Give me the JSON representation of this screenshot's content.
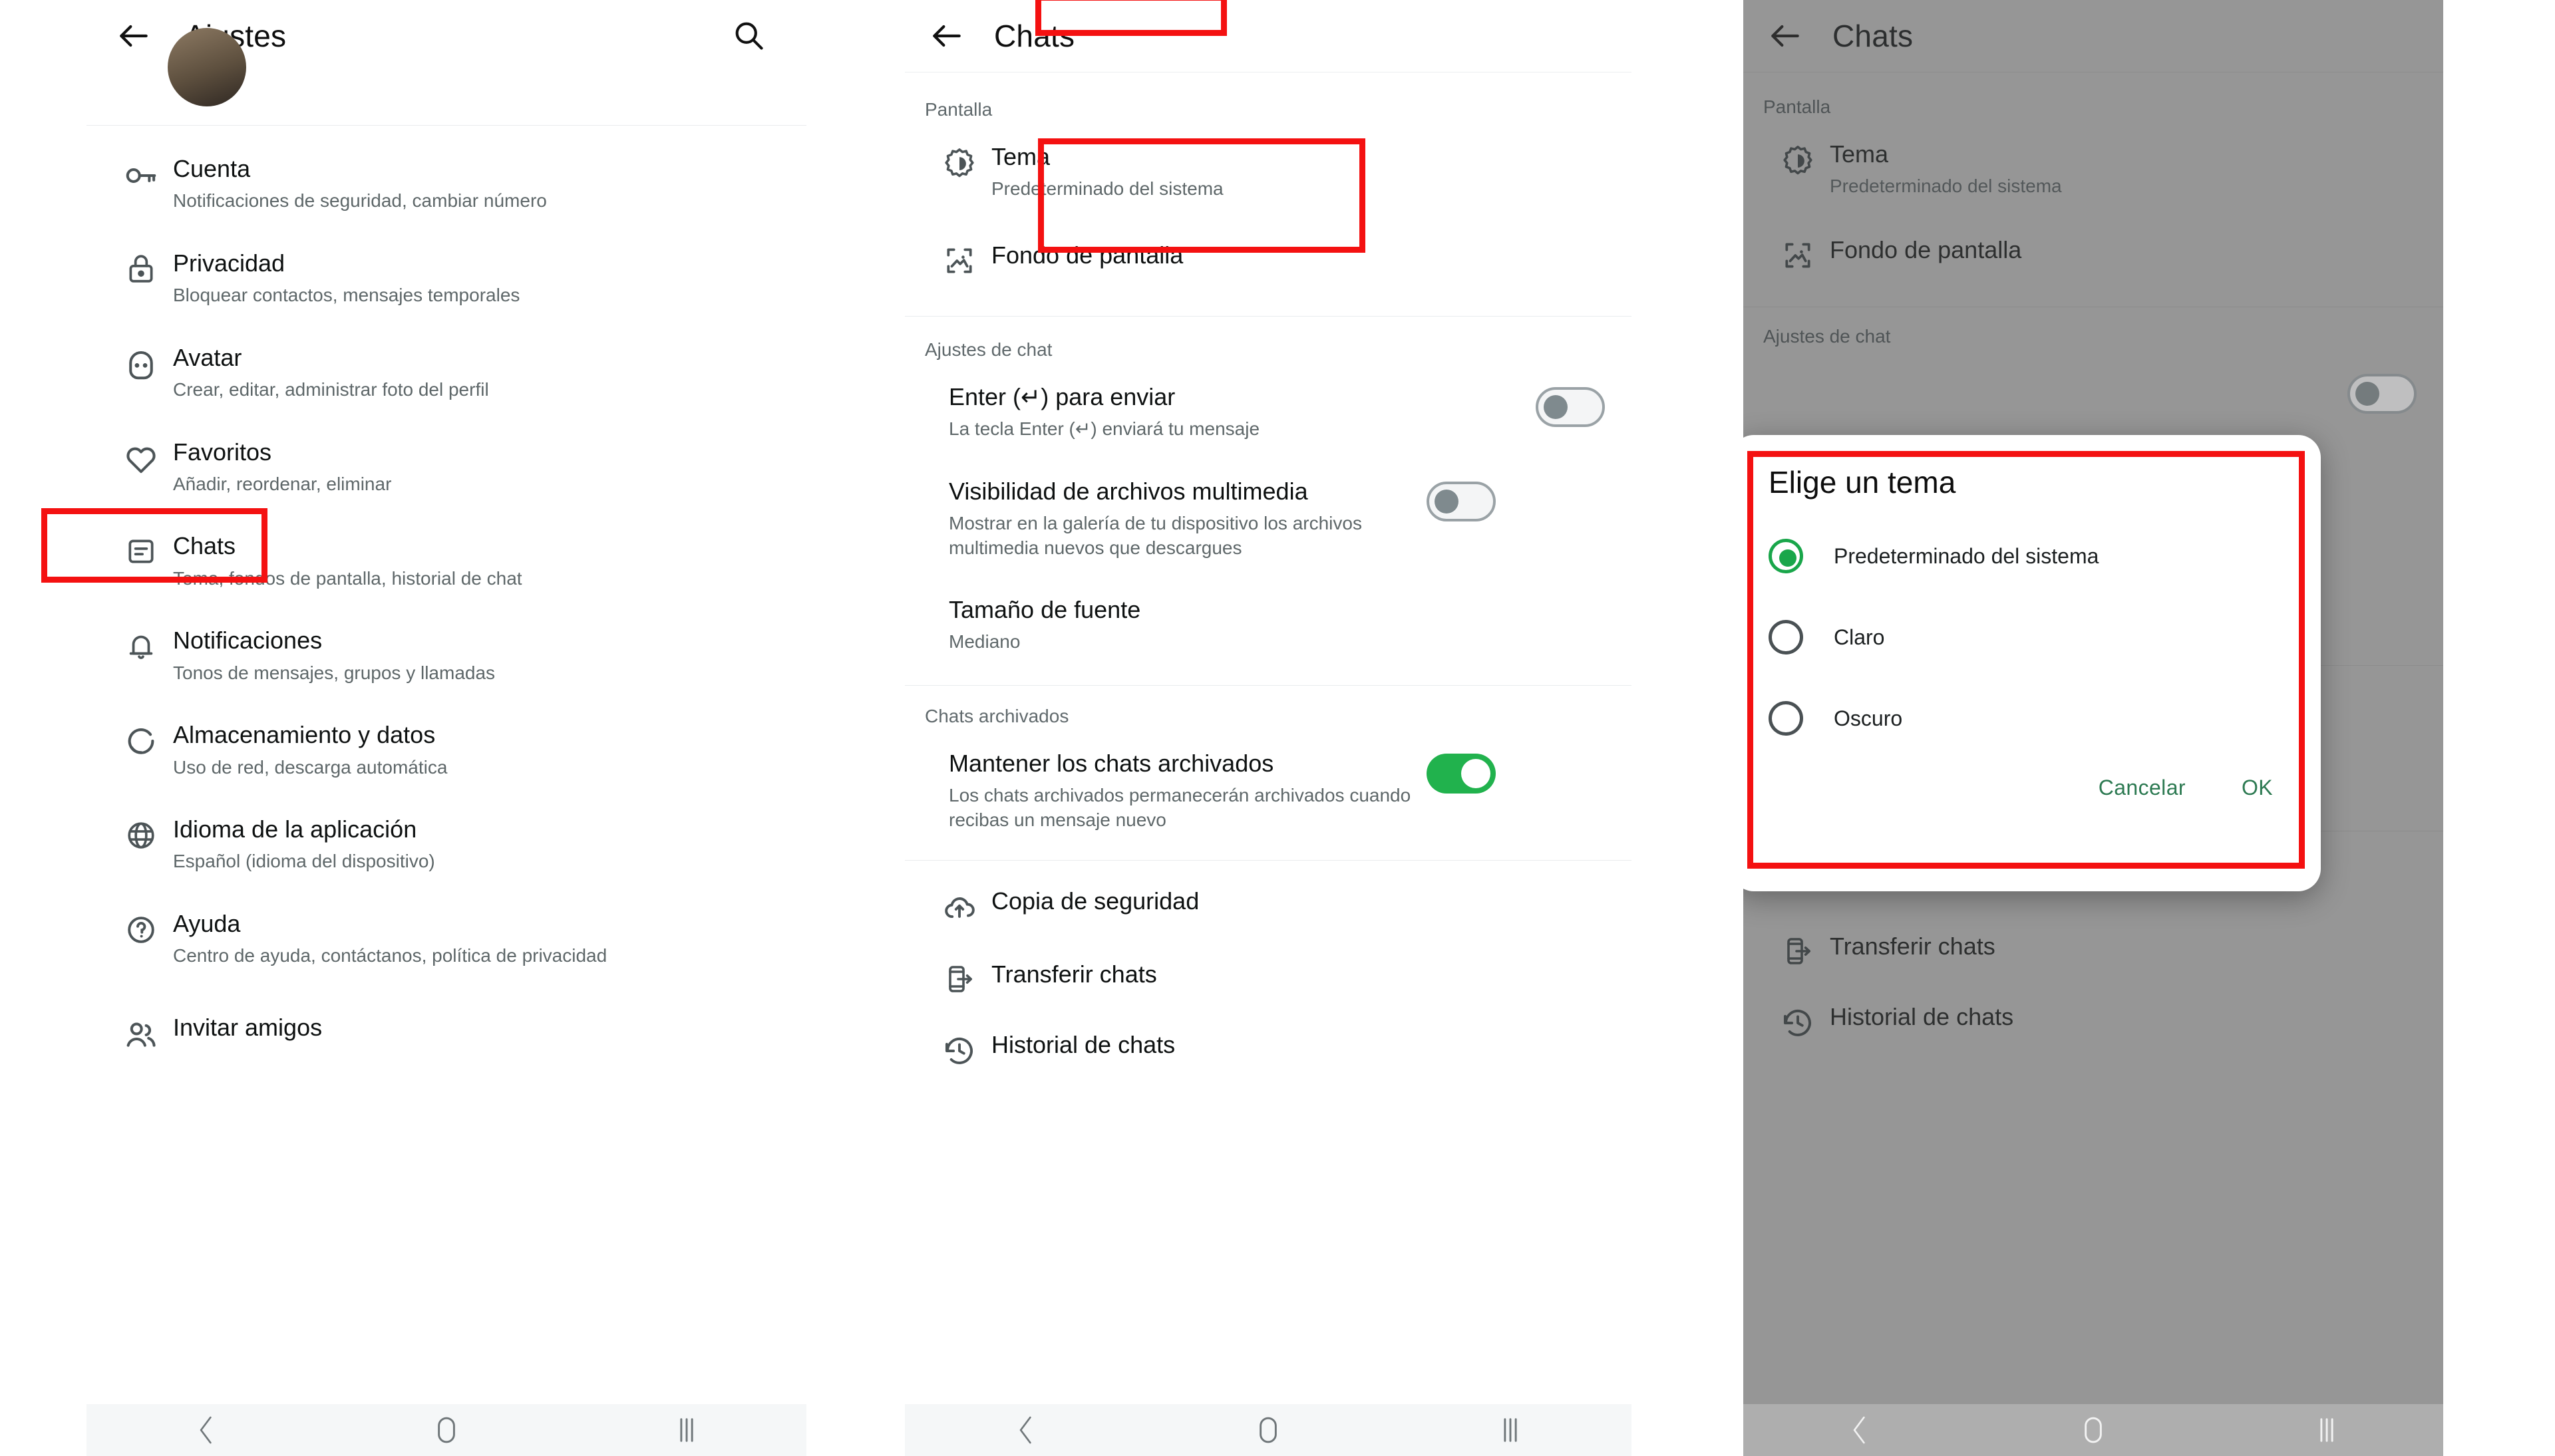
{
  "panels": {
    "settings": {
      "appbar": {
        "title": "Ajustes",
        "back_icon": "arrow-left-icon",
        "search_icon": "search-icon"
      },
      "items": [
        {
          "icon": "key-icon",
          "title": "Cuenta",
          "subtitle": "Notificaciones de seguridad, cambiar número"
        },
        {
          "icon": "lock-icon",
          "title": "Privacidad",
          "subtitle": "Bloquear contactos, mensajes temporales"
        },
        {
          "icon": "avatar-icon",
          "title": "Avatar",
          "subtitle": "Crear, editar, administrar foto del perfil"
        },
        {
          "icon": "heart-icon",
          "title": "Favoritos",
          "subtitle": "Añadir, reordenar, eliminar"
        },
        {
          "icon": "chat-icon",
          "title": "Chats",
          "subtitle": "Tema, fondos de pantalla, historial de chat"
        },
        {
          "icon": "bell-icon",
          "title": "Notificaciones",
          "subtitle": "Tonos de mensajes, grupos y llamadas"
        },
        {
          "icon": "storage-icon",
          "title": "Almacenamiento y datos",
          "subtitle": "Uso de red, descarga automática"
        },
        {
          "icon": "globe-icon",
          "title": "Idioma de la aplicación",
          "subtitle": "Español (idioma del dispositivo)"
        },
        {
          "icon": "help-icon",
          "title": "Ayuda",
          "subtitle": "Centro de ayuda, contáctanos, política de privacidad"
        },
        {
          "icon": "people-icon",
          "title": "Invitar amigos",
          "subtitle": ""
        }
      ]
    },
    "chats": {
      "appbar": {
        "title": "Chats",
        "back_icon": "arrow-left-icon"
      },
      "sections": [
        {
          "label": "Pantalla",
          "rows": [
            {
              "icon": "theme-icon",
              "title": "Tema",
              "subtitle": "Predeterminado del sistema",
              "toggle": null
            },
            {
              "icon": "wallpaper-icon",
              "title": "Fondo de pantalla",
              "subtitle": "",
              "toggle": null
            }
          ]
        },
        {
          "label": "Ajustes de chat",
          "rows": [
            {
              "icon": null,
              "title": "Enter (↵) para enviar",
              "subtitle": "La tecla Enter (↵) enviará tu mensaje",
              "toggle": "off"
            },
            {
              "icon": null,
              "title": "Visibilidad de archivos multimedia",
              "subtitle": "Mostrar en la galería de tu dispositivo los archivos multimedia nuevos que descargues",
              "toggle": "off"
            },
            {
              "icon": null,
              "title": "Tamaño de fuente",
              "subtitle": "Mediano",
              "toggle": null
            }
          ]
        },
        {
          "label": "Chats archivados",
          "rows": [
            {
              "icon": null,
              "title": "Mantener los chats archivados",
              "subtitle": "Los chats archivados permanecerán archivados cuando recibas un mensaje nuevo",
              "toggle": "on"
            }
          ]
        },
        {
          "label": "",
          "rows": [
            {
              "icon": "backup-icon",
              "title": "Copia de seguridad",
              "subtitle": "",
              "toggle": null
            },
            {
              "icon": "transfer-icon",
              "title": "Transferir chats",
              "subtitle": "",
              "toggle": null
            },
            {
              "icon": "history-icon",
              "title": "Historial de chats",
              "subtitle": "",
              "toggle": null
            }
          ]
        }
      ]
    },
    "dialog_panel": {
      "appbar": {
        "title": "Chats",
        "back_icon": "arrow-left-icon"
      },
      "dialog": {
        "title": "Elige un tema",
        "options": [
          {
            "label": "Predeterminado del sistema",
            "selected": true
          },
          {
            "label": "Claro",
            "selected": false
          },
          {
            "label": "Oscuro",
            "selected": false
          }
        ],
        "cancel_label": "Cancelar",
        "ok_label": "OK"
      }
    }
  },
  "navbar": {
    "back_icon": "nav-back-icon",
    "home_icon": "nav-home-icon",
    "recents_icon": "nav-recents-icon"
  },
  "colors": {
    "toggle_on": "#21b24d",
    "annotation": "#f41111",
    "dialog_action": "#2d7a52",
    "radio_selected": "#19a64a"
  }
}
